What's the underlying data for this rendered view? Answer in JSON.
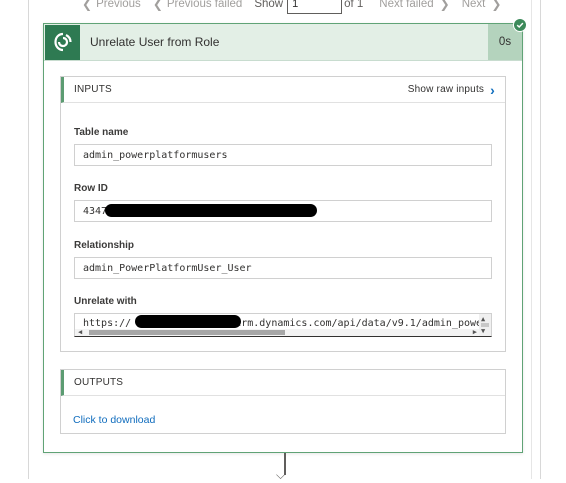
{
  "pager": {
    "previous_label": "Previous",
    "previous_failed_label": "Previous failed",
    "show_label": "Show",
    "page_value": "1",
    "of_label": "of 1",
    "next_failed_label": "Next failed",
    "next_label": "Next"
  },
  "action": {
    "title": "Unrelate User from Role",
    "duration": "0s",
    "status": "succeeded",
    "icon": "dataverse-icon",
    "status_icon": "check-icon",
    "accent_color": "#2e7a52"
  },
  "inputs": {
    "heading": "INPUTS",
    "show_raw_label": "Show raw inputs",
    "fields": [
      {
        "label": "Table name",
        "value": "admin_powerplatformusers"
      },
      {
        "label": "Row ID",
        "value": "4347"
      },
      {
        "label": "Relationship",
        "value": "admin_PowerPlatformUser_User"
      },
      {
        "label": "Unrelate with",
        "value": "https://",
        "value_suffix": ".crm.dynamics.com/api/data/v9.1/admin_powe"
      }
    ]
  },
  "outputs": {
    "heading": "OUTPUTS",
    "download_label": "Click to download"
  }
}
